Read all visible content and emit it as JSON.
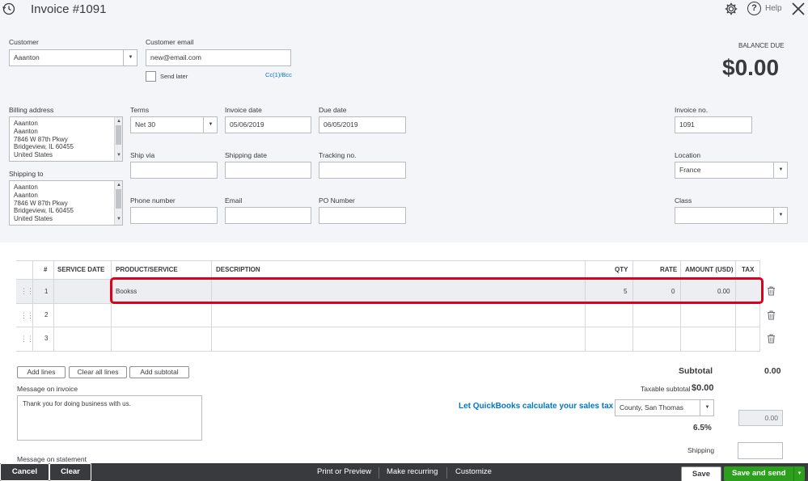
{
  "header": {
    "title": "Invoice #1091",
    "help_label": "Help"
  },
  "balance": {
    "label": "BALANCE DUE",
    "amount": "$0.00"
  },
  "customer": {
    "label": "Customer",
    "value": "Aaanton"
  },
  "email": {
    "label": "Customer email",
    "value": "new@email.com",
    "send_later": "Send later",
    "cc_bcc": "Cc(1)/Bcc"
  },
  "billing": {
    "label": "Billing address",
    "lines": [
      "Aaanton",
      "Aaanton",
      "7846 W 87th Pkwy",
      "Bridgeview, IL  60455",
      "United States"
    ]
  },
  "shipping_to": {
    "label": "Shipping to",
    "lines": [
      "Aaanton",
      "Aaanton",
      "7846 W 87th Pkwy",
      "Bridgeview, IL  60455",
      "United States"
    ]
  },
  "terms": {
    "label": "Terms",
    "value": "Net 30"
  },
  "invoice_date": {
    "label": "Invoice date",
    "value": "05/06/2019"
  },
  "due_date": {
    "label": "Due date",
    "value": "06/05/2019"
  },
  "ship_via": {
    "label": "Ship via",
    "value": ""
  },
  "shipping_date": {
    "label": "Shipping date",
    "value": ""
  },
  "tracking": {
    "label": "Tracking no.",
    "value": ""
  },
  "phone": {
    "label": "Phone number",
    "value": ""
  },
  "email2": {
    "label": "Email",
    "value": ""
  },
  "po": {
    "label": "PO Number",
    "value": ""
  },
  "invoice_no": {
    "label": "Invoice no.",
    "value": "1091"
  },
  "location": {
    "label": "Location",
    "value": "France"
  },
  "class_field": {
    "label": "Class",
    "value": ""
  },
  "table": {
    "headers": [
      "#",
      "SERVICE DATE",
      "PRODUCT/SERVICE",
      "DESCRIPTION",
      "QTY",
      "RATE",
      "AMOUNT (USD)",
      "TAX"
    ],
    "rows": [
      {
        "num": "1",
        "date": "",
        "product": "Bookss",
        "desc": "",
        "qty": "5",
        "rate": "0",
        "amount": "0.00",
        "tax": ""
      },
      {
        "num": "2",
        "date": "",
        "product": "",
        "desc": "",
        "qty": "",
        "rate": "",
        "amount": "",
        "tax": ""
      },
      {
        "num": "3",
        "date": "",
        "product": "",
        "desc": "",
        "qty": "",
        "rate": "",
        "amount": "",
        "tax": ""
      }
    ]
  },
  "actions": {
    "add_lines": "Add lines",
    "clear_all": "Clear all lines",
    "add_subtotal": "Add subtotal"
  },
  "message_invoice": {
    "label": "Message on invoice",
    "value": "Thank you for doing business with us."
  },
  "message_statement": {
    "label": "Message on statement"
  },
  "totals": {
    "subtotal_label": "Subtotal",
    "subtotal_value": "0.00",
    "taxable_label": "Taxable subtotal",
    "taxable_value": "$0.00",
    "sales_tax_link": "Let QuickBooks calculate your sales tax",
    "tax_rate_select": "County, San Thomas",
    "tax_rate": "6.5%",
    "tax_amount": "0.00",
    "shipping_label": "Shipping"
  },
  "footer": {
    "cancel": "Cancel",
    "clear": "Clear",
    "print": "Print or Preview",
    "recurring": "Make recurring",
    "customize": "Customize",
    "save": "Save",
    "save_send": "Save and send"
  },
  "colors": {
    "highlight": "#e0001b",
    "link": "#0077c5",
    "save_send": "#2ca01c",
    "footer_bg": "#393a3d"
  }
}
